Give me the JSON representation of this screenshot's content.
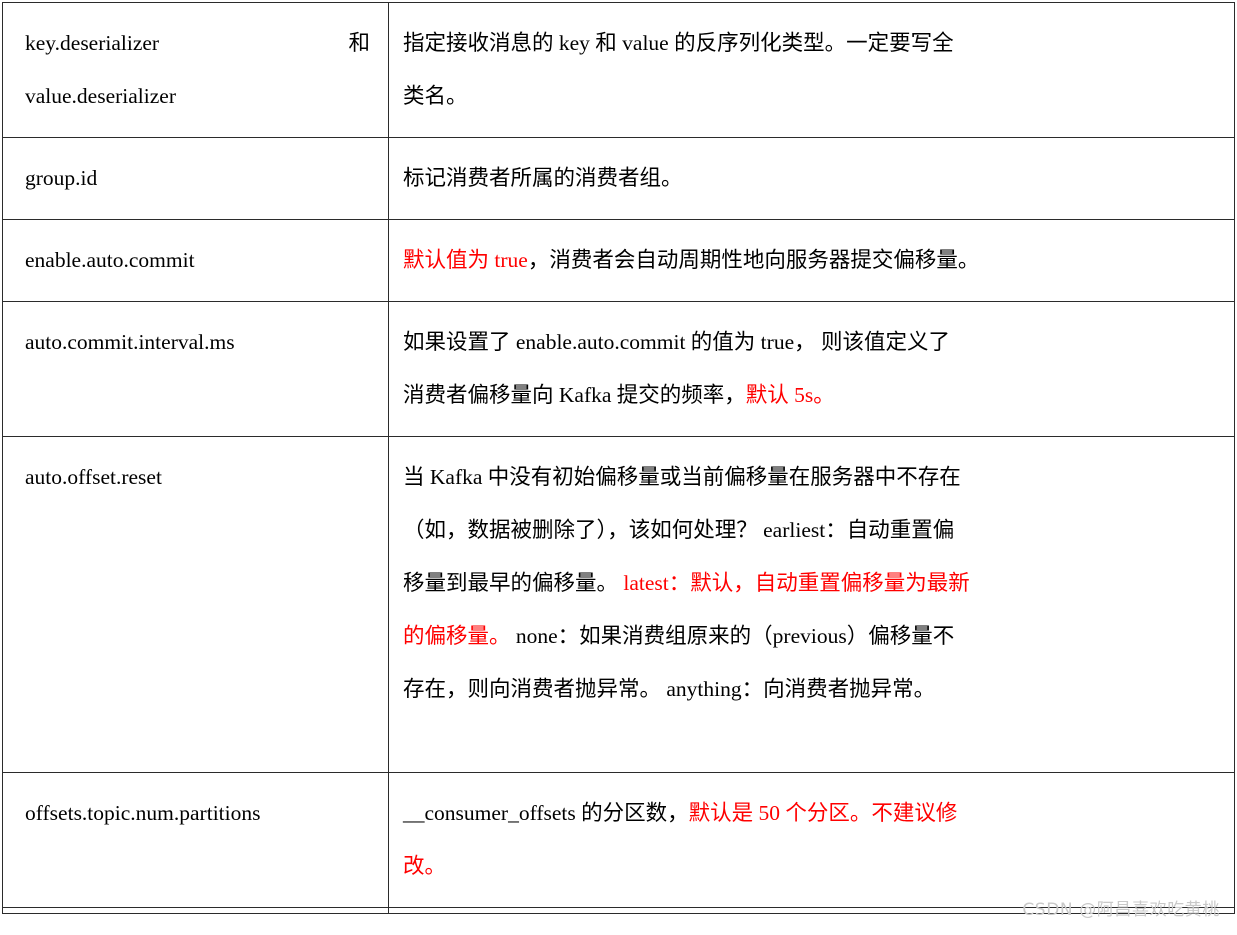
{
  "document": {
    "type": "parameter-reference-table",
    "language": "zh-CN",
    "columns": 2,
    "accent_red": "#ff0000",
    "text_color": "#000000",
    "border_color": "#2b2b2b",
    "background": "#ffffff"
  },
  "table": {
    "rows": [
      {
        "param_line1": "key.deserializer",
        "param_line1_tail": "和",
        "param_line2": "value.deserializer",
        "desc_line1": "指定接收消息的 key 和 value 的反序列化类型。一定要写全",
        "desc_line2": "类名。"
      },
      {
        "param": "group.id",
        "desc_line1": "标记消费者所属的消费者组。"
      },
      {
        "param": "enable.auto.commit",
        "desc_red1": "默认值为 true",
        "desc_rest1": "，消费者会自动周期性地向服务器提交偏移量。"
      },
      {
        "param": "auto.commit.interval.ms",
        "desc_line1": "如果设置了 enable.auto.commit 的值为 true， 则该值定义了",
        "desc_line2_pre": "消费者偏移量向 Kafka 提交的频率，",
        "desc_line2_red": "默认 5s。"
      },
      {
        "param": "auto.offset.reset",
        "desc_line1": "当 Kafka 中没有初始偏移量或当前偏移量在服务器中不存在",
        "desc_line2": "（如，数据被删除了），该如何处理？  earliest：自动重置偏",
        "desc_line3_pre": "移量到最早的偏移量。 ",
        "desc_line3_red": "latest：默认，自动重置偏移量为最新",
        "desc_line4_red": "的偏移量。",
        "desc_line4_rest": "  none：如果消费组原来的（previous）偏移量不",
        "desc_line5": "存在，则向消费者抛异常。  anything：向消费者抛异常。"
      },
      {
        "param": "offsets.topic.num.partitions",
        "desc_line1_pre": "__consumer_offsets 的分区数，",
        "desc_line1_red": "默认是 50 个分区。不建议修",
        "desc_line2_red": "改。"
      }
    ]
  },
  "watermark": {
    "text": "CSDN @阿昌喜欢吃黄桃"
  }
}
